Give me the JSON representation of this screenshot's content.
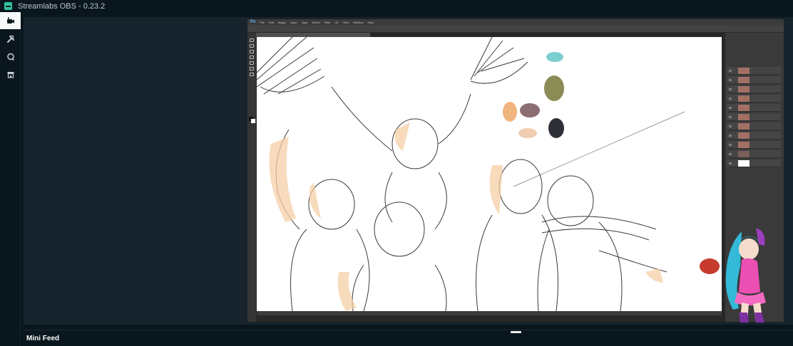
{
  "app": {
    "title": "Streamlabs OBS - 0.23.2",
    "accent_color": "#31c3a2",
    "background_color": "#09161d"
  },
  "sidebar": {
    "items": [
      {
        "icon": "studio-camera-icon",
        "active": true
      },
      {
        "icon": "wrench-tools-icon",
        "active": false
      },
      {
        "icon": "chat-bubble-icon",
        "active": false
      },
      {
        "icon": "store-icon",
        "active": false
      }
    ]
  },
  "preview": {
    "source_app": "Ps",
    "menu_items": [
      "File",
      "Edit",
      "Image",
      "Layer",
      "Type",
      "Select",
      "Filter",
      "3D",
      "View",
      "Window",
      "Help"
    ],
    "palette_swatches": [
      "#7ccfd0",
      "#8a8b55",
      "#f0b47e",
      "#8c6d72",
      "#2f2f36",
      "#f0cdb0",
      "#c73b2e"
    ]
  },
  "mini_feed": {
    "label": "Mini Feed"
  }
}
